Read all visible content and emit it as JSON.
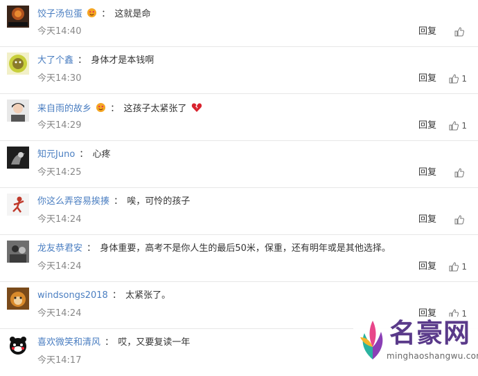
{
  "comments": [
    {
      "username": "饺子汤包蛋",
      "emoji": "smiling-face-with-heart-eyes-icon",
      "text": "这就是命",
      "time": "今天14:40",
      "reply_label": "回复",
      "likes": ""
    },
    {
      "username": "大了个鑫",
      "emoji": "",
      "text": "身体才是本钱啊",
      "time": "今天14:30",
      "reply_label": "回复",
      "likes": "1"
    },
    {
      "username": "来自雨的故乡",
      "emoji": "smiling-face-with-heart-eyes-icon",
      "text": "这孩子太紧张了",
      "trailing_emoji": "broken-heart-icon",
      "time": "今天14:29",
      "reply_label": "回复",
      "likes": "1"
    },
    {
      "username": "知元Juno",
      "emoji": "",
      "text": "心疼",
      "time": "今天14:25",
      "reply_label": "回复",
      "likes": ""
    },
    {
      "username": "你这么弄容易挨揍",
      "emoji": "",
      "text": "唉，可怜的孩子",
      "time": "今天14:24",
      "reply_label": "回复",
      "likes": ""
    },
    {
      "username": "龙友恭君安",
      "emoji": "",
      "text": "身体重要，高考不是你人生的最后50米，保重，还有明年或是其他选择。",
      "time": "今天14:24",
      "reply_label": "回复",
      "likes": "1"
    },
    {
      "username": "windsongs2018",
      "emoji": "",
      "text": "太紧张了。",
      "time": "今天14:24",
      "reply_label": "回复",
      "likes": "1"
    },
    {
      "username": "喜欢微笑和清风",
      "emoji": "",
      "text": "哎，又要复读一年",
      "time": "今天14:17",
      "reply_label": "",
      "likes": ""
    }
  ],
  "colon": "：",
  "watermark": {
    "title": "名豪网",
    "url": "minghaoshangwu.com"
  },
  "colors": {
    "username": "#4a7ec1",
    "time": "#888888",
    "divider": "#e6e6e6",
    "watermark": "#5a3a8a"
  }
}
